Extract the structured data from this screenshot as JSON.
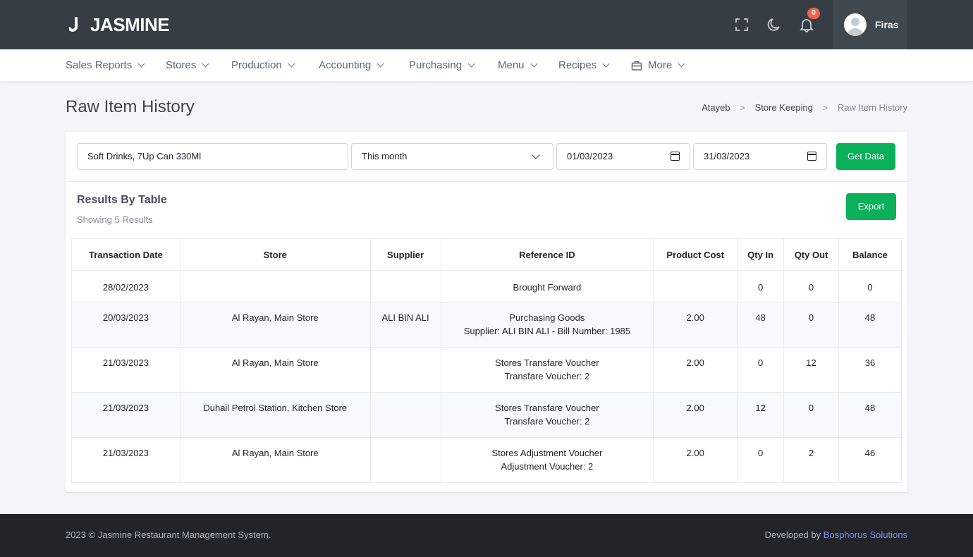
{
  "app": {
    "brand": "JASMINE",
    "notifications_count": "0",
    "user_name": "Firas"
  },
  "nav": {
    "items": [
      {
        "label": "Sales Reports",
        "icon": "chevron-down-icon"
      },
      {
        "label": "Stores",
        "icon": "chevron-down-icon"
      },
      {
        "label": "Production",
        "icon": "chevron-down-icon"
      },
      {
        "label": "Accounting",
        "icon": "chevron-down-icon"
      },
      {
        "label": "Purchasing",
        "icon": "chevron-down-icon"
      },
      {
        "label": "Menu",
        "icon": "chevron-down-icon"
      },
      {
        "label": "Recipes",
        "icon": "chevron-down-icon"
      },
      {
        "label": "More",
        "icon": "briefcase-icon"
      }
    ]
  },
  "page": {
    "title": "Raw Item History",
    "breadcrumb": [
      "Atayeb",
      "Store Keeping",
      "Raw Item History"
    ]
  },
  "filters": {
    "item_value": "Soft Drinks, 7Up Can 330Ml",
    "period_value": "This month",
    "from_date": "01/03/2023",
    "to_date": "31/03/2023",
    "get_data_label": "Get Data"
  },
  "results": {
    "title": "Results By Table",
    "subtitle": "Showing 5 Results",
    "export_label": "Export",
    "columns": [
      "Transaction Date",
      "Store",
      "Supplier",
      "Reference ID",
      "Product Cost",
      "Qty In",
      "Qty Out",
      "Balance"
    ],
    "rows": [
      {
        "date": "28/02/2023",
        "store": "",
        "supplier": "",
        "ref_line1": "Brought Forward",
        "ref_line2": "",
        "cost": "",
        "qty_in": "0",
        "qty_out": "0",
        "balance": "0"
      },
      {
        "date": "20/03/2023",
        "store": "Al Rayan, Main Store",
        "supplier": "ALI BIN ALI",
        "ref_line1": "Purchasing Goods",
        "ref_line2": "Supplier: ALI BIN ALI - Bill Number: 1985",
        "cost": "2.00",
        "qty_in": "48",
        "qty_out": "0",
        "balance": "48"
      },
      {
        "date": "21/03/2023",
        "store": "Al Rayan, Main Store",
        "supplier": "",
        "ref_line1": "Stores Transfare Voucher",
        "ref_line2": "Transfare Voucher: 2",
        "cost": "2.00",
        "qty_in": "0",
        "qty_out": "12",
        "balance": "36"
      },
      {
        "date": "21/03/2023",
        "store": "Duhail Petrol Station, Kitchen Store",
        "supplier": "",
        "ref_line1": "Stores Transfare Voucher",
        "ref_line2": "Transfare Voucher: 2",
        "cost": "2.00",
        "qty_in": "12",
        "qty_out": "0",
        "balance": "48"
      },
      {
        "date": "21/03/2023",
        "store": "Al Rayan, Main Store",
        "supplier": "",
        "ref_line1": "Stores Adjustment Voucher",
        "ref_line2": "Adjustment Voucher: 2",
        "cost": "2.00",
        "qty_in": "0",
        "qty_out": "2",
        "balance": "46"
      }
    ]
  },
  "footer": {
    "copyright": "2023 © Jasmine Restaurant Management System.",
    "developed_by": "Developed by",
    "developer": "Bosphorus Solutions"
  },
  "colors": {
    "topbar": "#363d44",
    "accent_green": "#0ab05a",
    "badge": "#f06548",
    "footer": "#212529",
    "link": "#7b8cf5"
  }
}
